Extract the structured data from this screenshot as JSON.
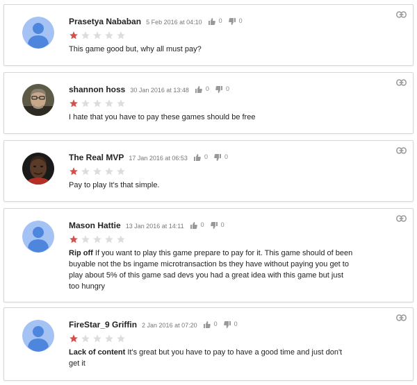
{
  "reviews": [
    {
      "author": "Prasetya Nababan",
      "date": "5 Feb 2016 at 04:10",
      "helpful_count": "0",
      "unhelpful_count": "0",
      "rating": 1,
      "max_rating": 5,
      "avatar": "default-avatar",
      "title": "",
      "body": "This game good but, why all must pay?"
    },
    {
      "author": "shannon hoss",
      "date": "30 Jan 2016 at 13:48",
      "helpful_count": "0",
      "unhelpful_count": "0",
      "rating": 1,
      "max_rating": 5,
      "avatar": "photo-man-glasses",
      "title": "",
      "body": "I hate that you have to pay these games should be free"
    },
    {
      "author": "The Real MVP",
      "date": "17 Jan 2016 at 06:53",
      "helpful_count": "0",
      "unhelpful_count": "0",
      "rating": 1,
      "max_rating": 5,
      "avatar": "photo-man-dark",
      "title": "",
      "body": "Pay to play It's that simple."
    },
    {
      "author": "Mason Hattie",
      "date": "13 Jan 2016 at 14:11",
      "helpful_count": "0",
      "unhelpful_count": "0",
      "rating": 1,
      "max_rating": 5,
      "avatar": "default-avatar",
      "title": "Rip off",
      "body": "If you want to play this game prepare to pay for it. This game should of been buyable not the bs ingame microtransaction bs they have without paying you get to play about 5% of this game sad devs you had a great idea with this game but just too hungry"
    },
    {
      "author": "FireStar_9 Griffin",
      "date": "2 Jan 2016 at 07:20",
      "helpful_count": "0",
      "unhelpful_count": "0",
      "rating": 1,
      "max_rating": 5,
      "avatar": "default-avatar",
      "title": "Lack of content",
      "body": "It's great but you have to pay to have a good time and just don't get it"
    }
  ],
  "colors": {
    "star_filled": "#d5504a",
    "star_empty": "#dddddd",
    "avatar_bg": "#a4c2f4",
    "avatar_fg": "#4e86de",
    "border": "#d6d6d6"
  },
  "icons": {
    "helpful": "thumbs-up-icon",
    "unhelpful": "thumbs-down-icon",
    "permalink": "link-icon"
  }
}
